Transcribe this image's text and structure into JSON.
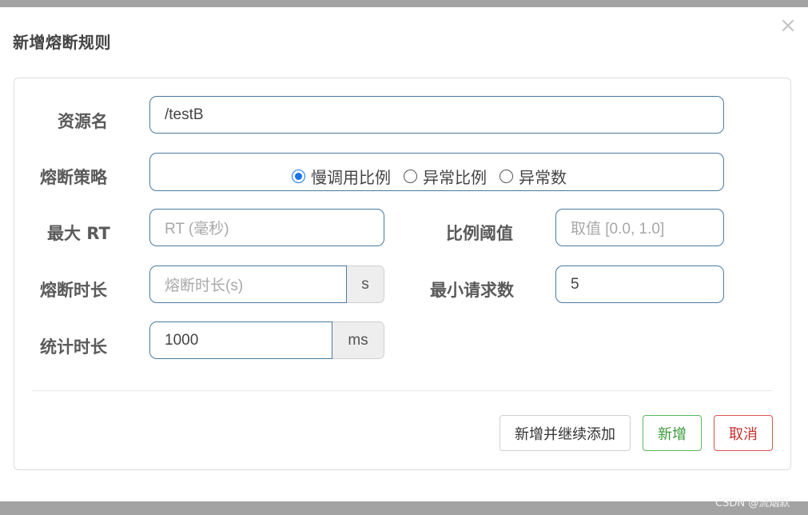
{
  "dialog": {
    "title": "新增熔断规则",
    "close_glyph": "×"
  },
  "form": {
    "resource": {
      "label": "资源名",
      "value": "/testB"
    },
    "strategy": {
      "label": "熔断策略",
      "options": [
        "慢调用比例",
        "异常比例",
        "异常数"
      ],
      "selected": "慢调用比例"
    },
    "max_rt": {
      "label": "最大 RT",
      "placeholder": "RT (毫秒)"
    },
    "ratio_threshold": {
      "label": "比例阈值",
      "placeholder": "取值 [0.0, 1.0]"
    },
    "break_duration": {
      "label": "熔断时长",
      "placeholder": "熔断时长(s)",
      "unit": "s"
    },
    "min_requests": {
      "label": "最小请求数",
      "value": "5"
    },
    "stat_duration": {
      "label": "统计时长",
      "value": "1000",
      "unit": "ms"
    }
  },
  "buttons": {
    "add_continue": "新增并继续添加",
    "add": "新增",
    "cancel": "取消"
  },
  "watermark": "CSDN @流烟默",
  "colors": {
    "accent": "#1a73e8",
    "field_border": "#4a7ba0",
    "success": "#5cb85c",
    "danger": "#d9534f"
  }
}
